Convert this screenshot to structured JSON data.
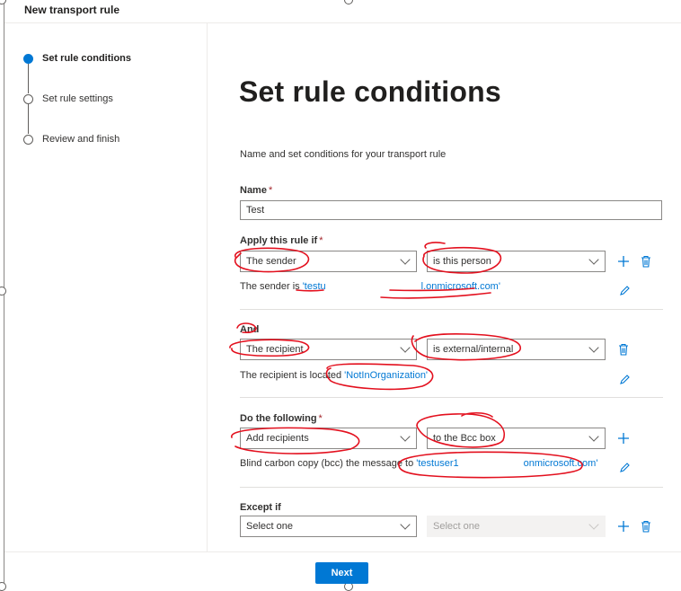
{
  "header": {
    "title": "New transport rule"
  },
  "steps": [
    {
      "label": "Set rule conditions",
      "active": true
    },
    {
      "label": "Set rule settings",
      "active": false
    },
    {
      "label": "Review and finish",
      "active": false
    }
  ],
  "main": {
    "title": "Set rule conditions",
    "description": "Name and set conditions for your transport rule",
    "name_field": {
      "label": "Name",
      "required_mark": "*",
      "value": "Test"
    },
    "apply_rule": {
      "label": "Apply this rule if",
      "required_mark": "*",
      "condition": "The sender",
      "operator": "is this person",
      "summary_prefix": "The sender is ",
      "summary_link_start": "'testu",
      "summary_link_end": "l.onmicrosoft.com'"
    },
    "and_rule": {
      "label": "And",
      "condition": "The recipient",
      "operator": "is external/internal",
      "summary_prefix": "The recipient is located ",
      "summary_link": "'NotInOrganization'"
    },
    "do_following": {
      "label": "Do the following",
      "required_mark": "*",
      "action": "Add recipients",
      "operator": "to the Bcc box",
      "summary_prefix": "Blind carbon copy (bcc) the message to ",
      "summary_link_start": "'testuser1",
      "summary_link_end": "onmicrosoft.com'"
    },
    "except_if": {
      "label": "Except if",
      "placeholder": "Select one",
      "placeholder_disabled": "Select one"
    }
  },
  "footer": {
    "next_label": "Next"
  },
  "colors": {
    "accent": "#0078d4",
    "required": "#a4262c",
    "annotation": "#e3101e"
  },
  "icons": [
    "plus-icon",
    "trash-icon",
    "pencil-icon",
    "chevron-down-icon"
  ]
}
